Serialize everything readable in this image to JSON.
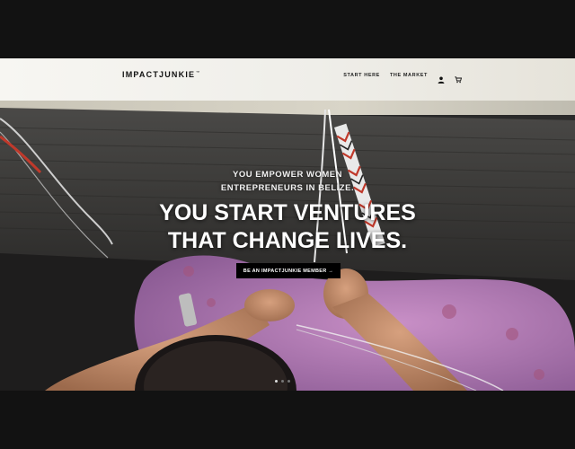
{
  "header": {
    "logo_text": "IMPACTJUNKIE",
    "logo_mark": "™",
    "nav": [
      {
        "label": "START HERE"
      },
      {
        "label": "THE MARKET"
      }
    ],
    "icons": [
      "user-icon",
      "cart-icon"
    ]
  },
  "hero": {
    "subtitle_line1": "YOU EMPOWER WOMEN",
    "subtitle_line2": "ENTREPRENEURS IN BELIZE.",
    "headline_line1": "YOU START VENTURES",
    "headline_line2": "THAT CHANGE LIVES.",
    "cta_label": "BE AN IMPACTJUNKIE MEMBER →"
  },
  "carousel": {
    "slide_count": 3,
    "active_index": 0
  },
  "colors": {
    "frame": "#121212",
    "header_bg": "#f4f3ef",
    "cta_bg": "#000000",
    "text_light": "#ffffff"
  }
}
